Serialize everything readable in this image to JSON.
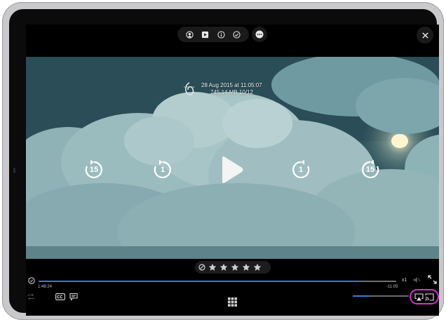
{
  "top_bar": {
    "icons": [
      "airplay-audio-icon",
      "play-box-icon",
      "info-icon",
      "check-circle-icon"
    ],
    "more_icon": "more-icon",
    "close_icon": "close-icon"
  },
  "video": {
    "date_text": "28 Aug 2015 at 11:05:07",
    "info_text": "745.14 MB  10/12",
    "controls": {
      "skip_back_long": "15",
      "skip_back_short": "1",
      "skip_fwd_short": "1",
      "skip_fwd_long": "15"
    }
  },
  "rating": {
    "value": 0,
    "max": 5
  },
  "progress": {
    "elapsed": "1:48:24",
    "remaining": "-11:05",
    "fraction": 0.9,
    "speed": "x1"
  },
  "volume": {
    "fraction": 0.3
  },
  "colors": {
    "accent": "#2f7fd6",
    "highlight": "#d62fd6"
  }
}
